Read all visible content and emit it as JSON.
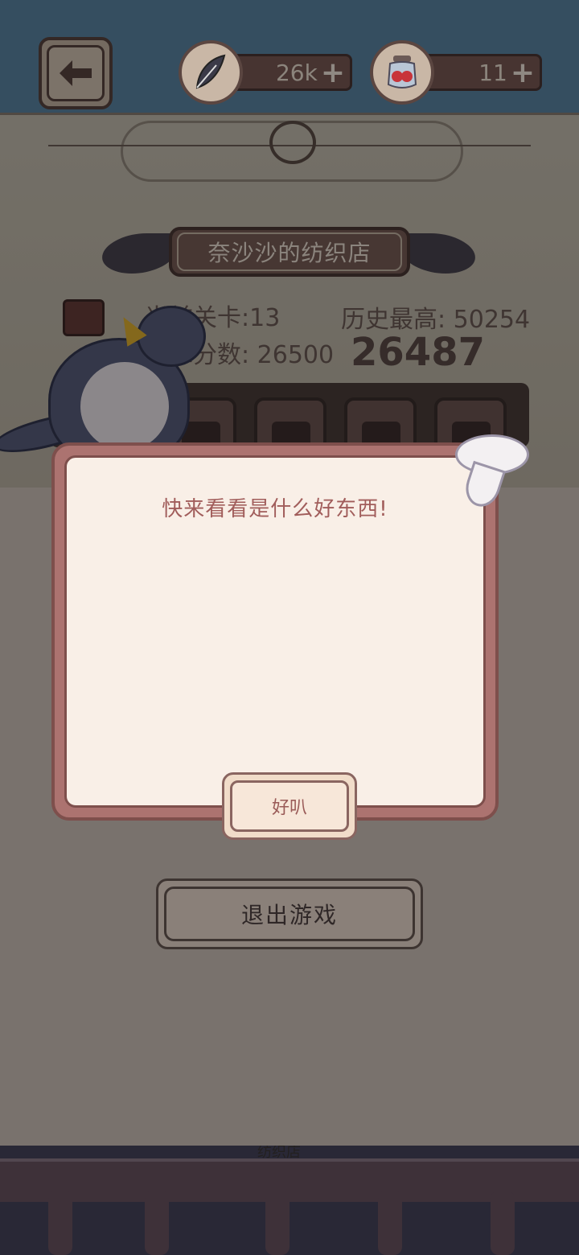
{
  "topbar": {
    "back_icon": "left-arrow-icon",
    "feather": {
      "icon": "feather-icon",
      "value": "26k",
      "plus": "+"
    },
    "jar": {
      "icon": "berry-jar-icon",
      "value": "11",
      "plus": "+"
    }
  },
  "shop": {
    "title": "奈沙沙的纺织店"
  },
  "stats": {
    "current_level": "当前关卡:13",
    "best": "历史最高: 50254",
    "target": "目标分数: 26500",
    "score": "26487"
  },
  "dialog": {
    "message": "快来看看是什么好东西!",
    "ok_label": "好叭"
  },
  "exit": {
    "label": "退出游戏"
  },
  "ground": {
    "sign": "纺织店"
  },
  "colors": {
    "dialog_frame": "#ac7370",
    "dialog_panel": "#f9efe7",
    "message_text": "#a15d5b",
    "overlay": "#79726d"
  }
}
